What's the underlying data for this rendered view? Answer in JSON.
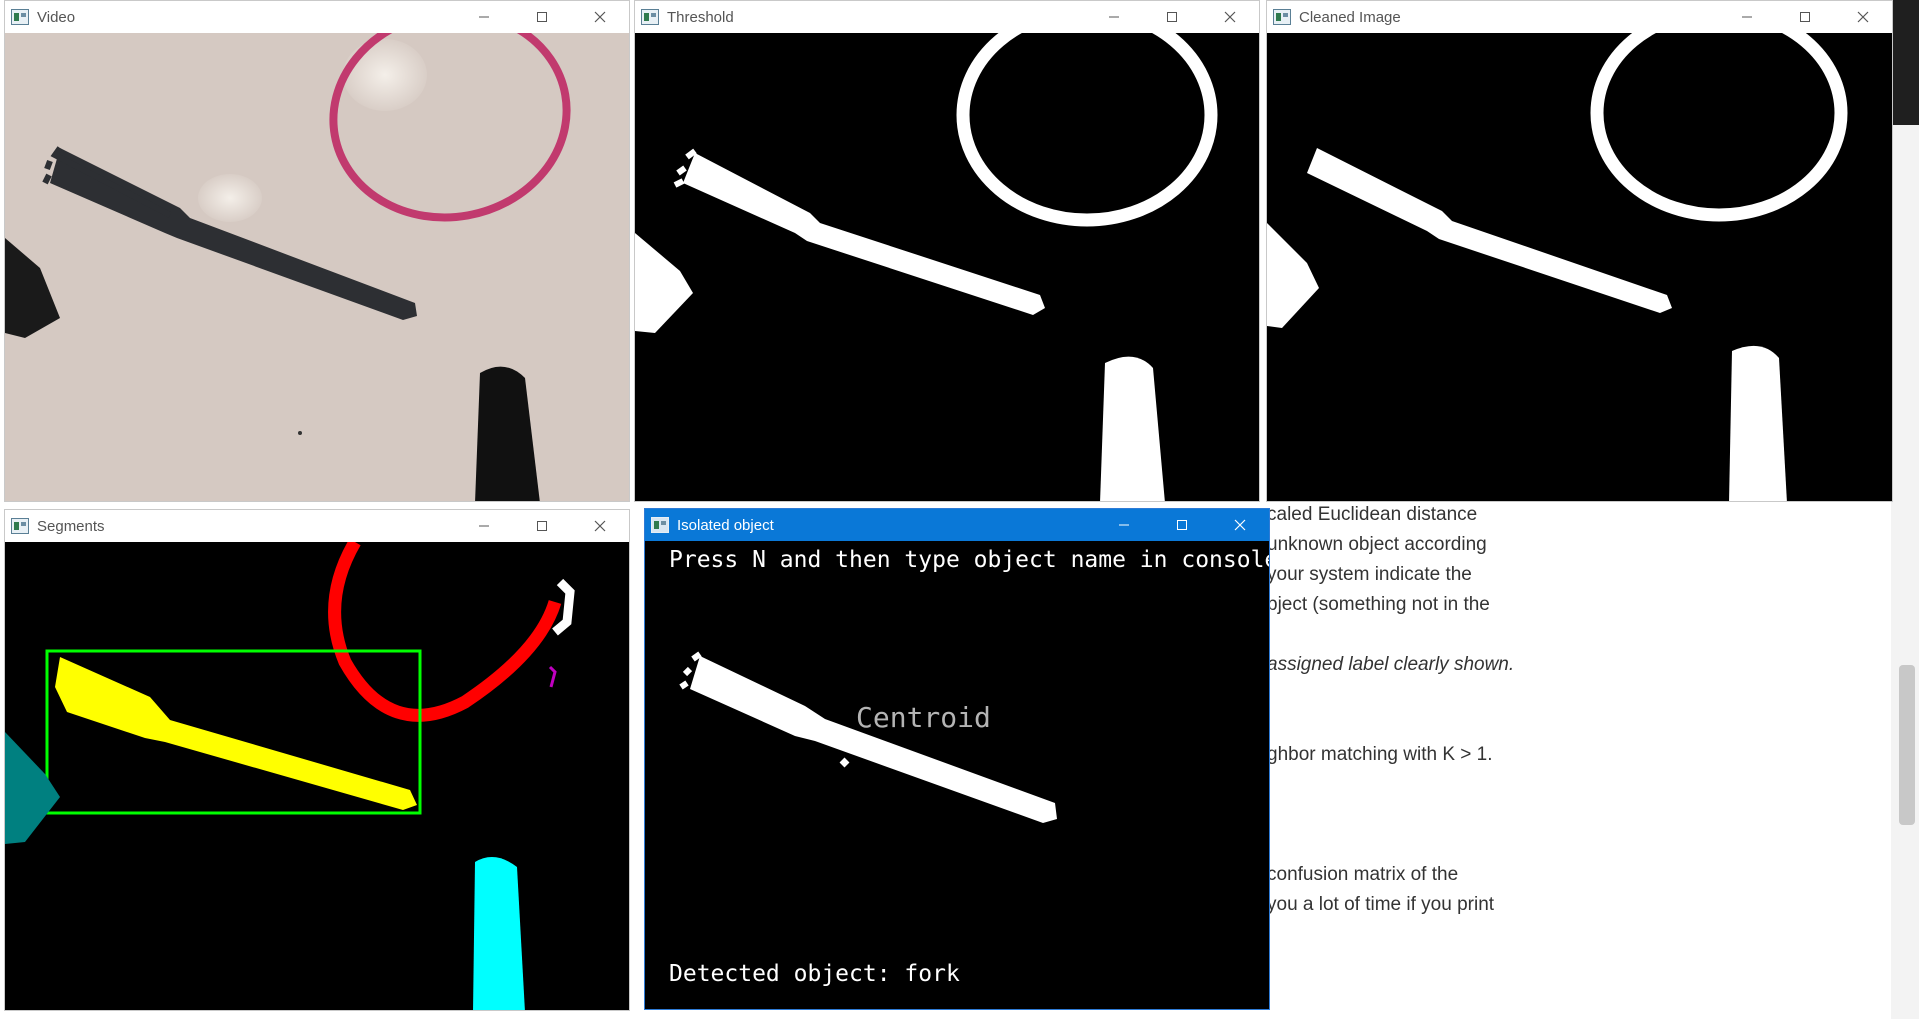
{
  "windows": {
    "video": {
      "title": "Video"
    },
    "threshold": {
      "title": "Threshold"
    },
    "cleaned": {
      "title": "Cleaned Image"
    },
    "segments": {
      "title": "Segments"
    },
    "isolated": {
      "title": "Isolated object",
      "instruction": "Press N and then type object name in console",
      "centroid_label": "Centroid",
      "detected": "Detected object: fork"
    }
  },
  "background_doc": {
    "lines": [
      "caled Euclidean distance",
      "unknown object according",
      "your system indicate the",
      "bject (something not in the",
      "",
      "assigned label clearly shown.",
      "",
      "",
      "ghbor matching with K > 1.",
      "",
      "",
      "",
      "confusion matrix of the",
      "you a lot of time if you print"
    ]
  },
  "colors": {
    "active_titlebar": "#0a78d7",
    "segment_yellow": "#ffff00",
    "segment_red": "#ff0000",
    "segment_cyan": "#00ffff",
    "segment_teal": "#008080",
    "bbox_green": "#00ff00"
  },
  "icons": [
    "app-icon",
    "minimize-icon",
    "maximize-icon",
    "close-icon"
  ]
}
